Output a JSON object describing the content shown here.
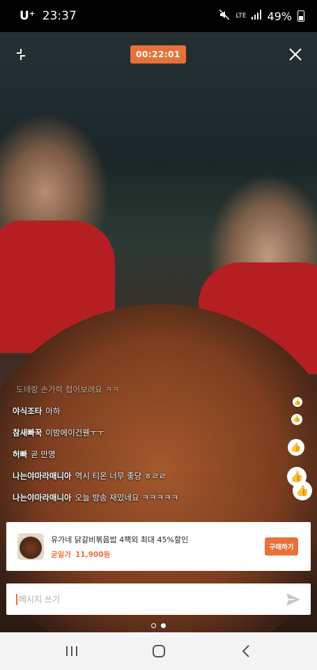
{
  "status_bar": {
    "carrier": "U⁺",
    "time": "23:37",
    "network": "LTE",
    "battery": "49%"
  },
  "live": {
    "timer": "00:22:01"
  },
  "chat": [
    {
      "user": "",
      "text": "도테랑 손가락 접어보려요 ㅋㅋ"
    },
    {
      "user": "야식조타",
      "text": "아하"
    },
    {
      "user": "참새빠꾹",
      "text": "이밤에이건웬ㅜㅜ"
    },
    {
      "user": "허빠",
      "text": "곧 만명"
    },
    {
      "user": "나는야마라매니아",
      "text": "역시 티온 너무 좋당 ㅎㄹㄹ"
    },
    {
      "user": "나는야마라매니아",
      "text": "오늘 방송 재밌네요 ㅋㅋㅋㅋㅋ"
    }
  ],
  "product": {
    "name": "유가네 닭갈비볶음밥 4팩외 최대 45%할인",
    "price_label": "굳일가",
    "price": "11,900원",
    "buy_label": "구매하기"
  },
  "message": {
    "placeholder": "메시지 쓰기"
  },
  "colors": {
    "accent": "#e8713a",
    "apron": "#b51f22"
  },
  "icons": [
    "fullscreen-icon",
    "close-icon",
    "thumbs-up-icon",
    "send-icon",
    "recents-icon",
    "home-icon",
    "back-icon"
  ]
}
